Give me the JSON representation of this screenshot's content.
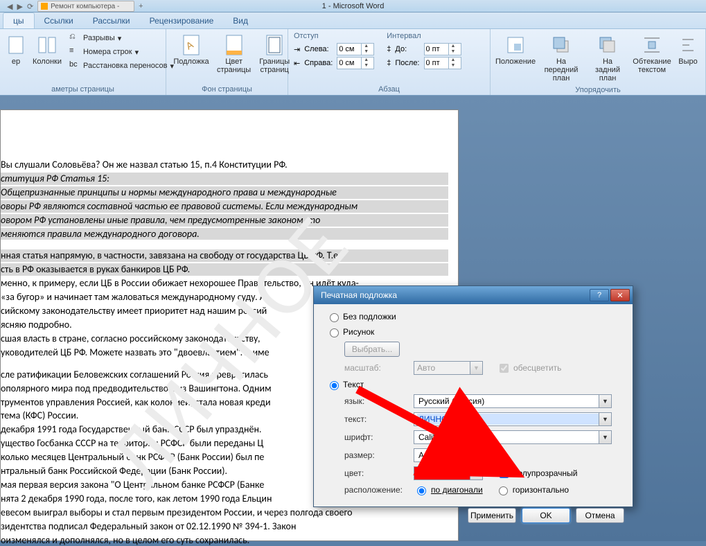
{
  "window": {
    "title": "1 - Microsoft Word",
    "browser_tab": "Ремонт компьютера -"
  },
  "ribbon_tabs": {
    "active": "цы",
    "items": [
      "цы",
      "Ссылки",
      "Рассылки",
      "Рецензирование",
      "Вид"
    ]
  },
  "ribbon": {
    "page_setup": {
      "label": "аметры страницы",
      "columns": "Колонки",
      "breaks": "Разрывы",
      "line_numbers": "Номера строк",
      "hyphenation": "Расстановка переносов"
    },
    "page_bg": {
      "label": "Фон страницы",
      "watermark": "Подложка",
      "page_color": "Цвет страницы",
      "page_borders": "Границы страниц"
    },
    "paragraph": {
      "label": "Абзац",
      "indent_label": "Отступ",
      "left": "Слева:",
      "right": "Справа:",
      "left_val": "0 см",
      "right_val": "0 см",
      "interval_label": "Интервал",
      "before": "До:",
      "after": "После:",
      "before_val": "0 пт",
      "after_val": "0 пт"
    },
    "arrange": {
      "label": "Упорядочить",
      "position": "Положение",
      "bring_front": "На передний план",
      "send_back": "На задний план",
      "text_wrap": "Обтекание текстом",
      "align": "Выро"
    }
  },
  "document": {
    "watermark_text": "ЛИЧНОЕ",
    "lines": [
      {
        "t": "Вы слушали Соловьёва? Он же назвал статью 15, п.4 Конституции РФ."
      },
      {
        "t": "ституция РФ Статья 15:",
        "cls": "hl itc"
      },
      {
        "t": "Общепризнанные принципы и нормы международного права и международные",
        "cls": "hl itc"
      },
      {
        "t": "оворы РФ являются составной частью ее правовой системы. Если международным",
        "cls": "hl itc"
      },
      {
        "t": "овором РФ установлены иные правила, чем предусмотренные законом, то",
        "cls": "hl itc"
      },
      {
        "t": "меняются правила международного договора.",
        "cls": "hl itc"
      },
      {
        "t": "",
        "cls": "sp"
      },
      {
        "t": "нная статья напрямую, в частности, завязана на свободу от государства ЦБ РФ. Т.е.",
        "cls": "hl"
      },
      {
        "t": "сть в РФ оказывается в руках банкиров ЦБ РФ.",
        "cls": "hl"
      },
      {
        "t": "менно, к примеру, если ЦБ в России обижает нехорошее Правительство, он идёт куда-"
      },
      {
        "t": "«за бугор» и начинает там жаловаться международному суду. А"
      },
      {
        "t": "сийскому законодательству имеет приоритет над нашим россий"
      },
      {
        "t": "ясняю подробно."
      },
      {
        "t": "сшая власть в стране, согласно российскому законодательству,"
      },
      {
        "t": "уководителей ЦБ РФ. Можете назвать это \"двоевластием\". А име"
      },
      {
        "t": "",
        "cls": "sp"
      },
      {
        "t": "сле ратификации Беловежских соглашений Россия превратилась"
      },
      {
        "t": "ополярного мира под предводительством из Вашингтона. Одним"
      },
      {
        "t": "трументов управления Россией, как колонией, стала новая креди"
      },
      {
        "t": "тема (КФС) России."
      },
      {
        "t": "декабря 1991 года Государственный банк СССР был упразднён."
      },
      {
        "t": "ущество Госбанка СССР на территории РСФСР были переданы Ц"
      },
      {
        "t": "колько месяцев Центральный банк РСФСР (Банк России) был пе"
      },
      {
        "t": "нтральный банк Российской Федерации (Банк России)."
      },
      {
        "t": "мая первая версия закона \"О Центральном банке РСФСР (Банке"
      },
      {
        "t": "нята 2 декабря 1990 года, после того, как летом 1990 года Ельцин"
      },
      {
        "t": "евесом выиграл выборы и стал первым президентом России, и через полгода своего"
      },
      {
        "t": "зидентства подписал Федеральный закон от 02.12.1990 № 394-1. Закон"
      },
      {
        "t": "оизменялся и дополнялся, но в целом его суть сохранилась."
      }
    ]
  },
  "dialog": {
    "title": "Печатная подложка",
    "opt_none": "Без подложки",
    "opt_picture": "Рисунок",
    "btn_select": "Выбрать...",
    "lbl_scale": "масштаб:",
    "val_scale": "Авто",
    "chk_washout": "обесцветить",
    "opt_text": "Текст",
    "lbl_lang": "язык:",
    "val_lang": "Русский (Россия)",
    "lbl_text": "текст:",
    "val_text": "ЛИЧНОЕ",
    "lbl_font": "шрифт:",
    "val_font": "Calibri",
    "lbl_size": "размер:",
    "val_size": "Авто",
    "lbl_color": "цвет:",
    "chk_semi": "полупрозрачный",
    "lbl_layout": "расположение:",
    "opt_diag": "по диагонали",
    "opt_horiz": "горизонтально",
    "btn_apply": "Применить",
    "btn_ok": "OK",
    "btn_cancel": "Отмена"
  }
}
